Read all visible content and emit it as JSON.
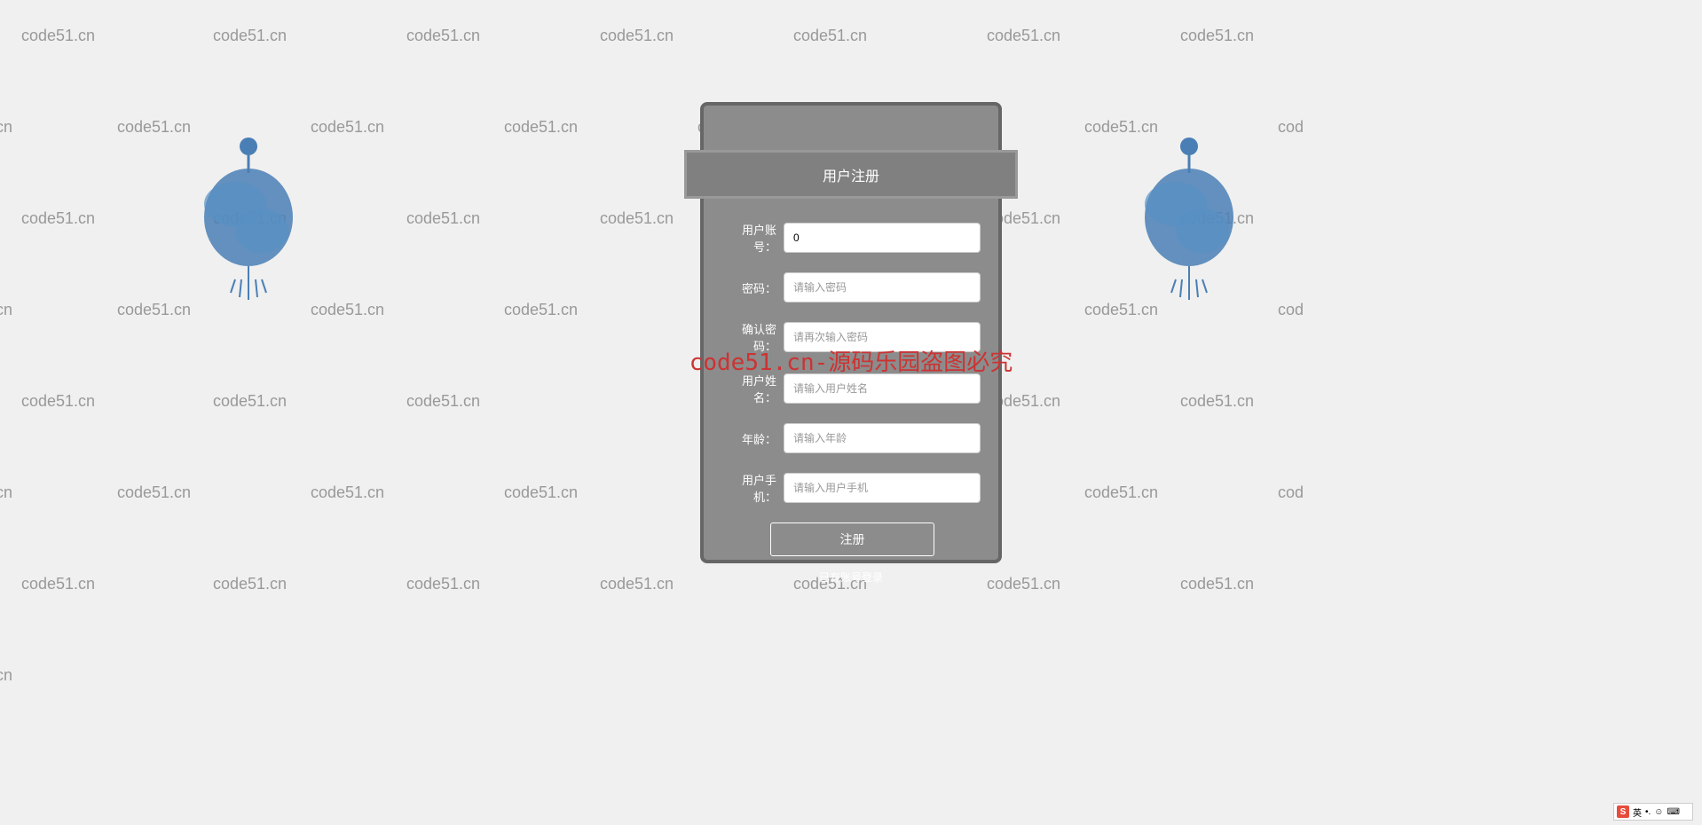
{
  "watermark_text": "code51.cn",
  "center_watermark": "code51.cn-源码乐园盗图必究",
  "form": {
    "title": "用户注册",
    "fields": {
      "account": {
        "label": "用户账号：",
        "value": "0",
        "placeholder": ""
      },
      "password": {
        "label": "密码：",
        "value": "",
        "placeholder": "请输入密码"
      },
      "confirm_password": {
        "label": "确认密码：",
        "value": "",
        "placeholder": "请再次输入密码"
      },
      "username": {
        "label": "用户姓名：",
        "value": "",
        "placeholder": "请输入用户姓名"
      },
      "age": {
        "label": "年龄：",
        "value": "",
        "placeholder": "请输入年龄"
      },
      "phone": {
        "label": "用户手机：",
        "value": "",
        "placeholder": "请输入用户手机"
      }
    },
    "submit_label": "注册",
    "login_link": "已有账号登录"
  },
  "ime": {
    "lang": "英"
  }
}
